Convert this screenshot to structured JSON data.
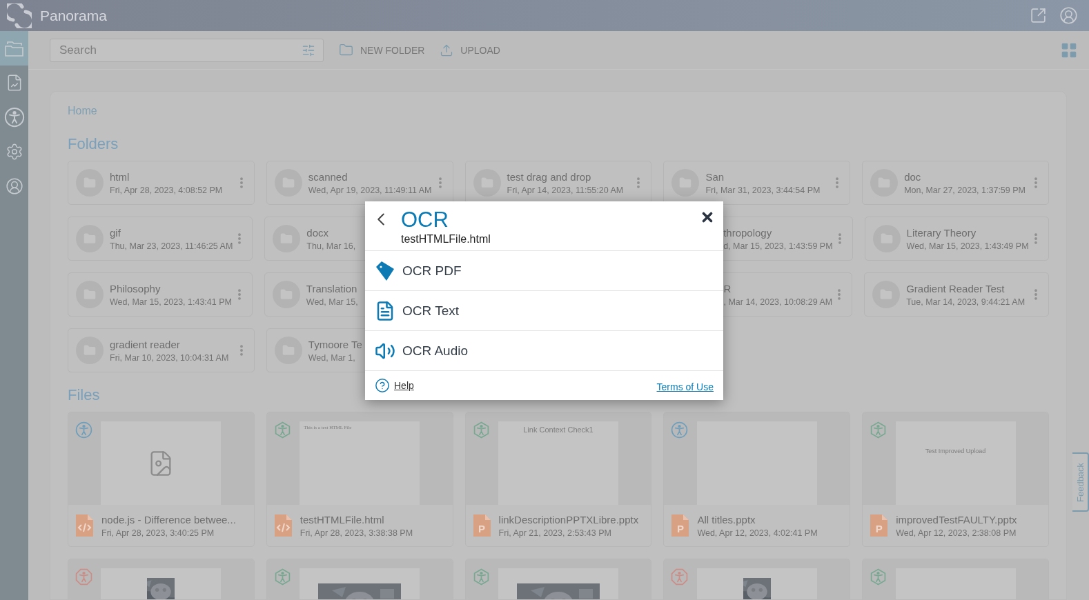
{
  "app": {
    "title": "Panorama"
  },
  "sidebar": {
    "items": [
      {
        "kind": "folders",
        "selected": true
      },
      {
        "kind": "reports",
        "selected": false
      },
      {
        "kind": "accessibility",
        "selected": false
      },
      {
        "kind": "settings",
        "selected": false
      },
      {
        "kind": "account",
        "selected": false
      }
    ]
  },
  "toolbar": {
    "search": {
      "placeholder": "Search"
    },
    "buttons": [
      {
        "kind": "new-folder",
        "label": "NEW FOLDER"
      },
      {
        "kind": "upload",
        "label": "UPLOAD"
      }
    ]
  },
  "breadcrumb": "Home",
  "folders_heading": "Folders",
  "folder_rows": [
    {
      "left": [
        {
          "name": "html",
          "date": "Fri, Apr 28, 2023, 4:08:52 PM"
        },
        {
          "name": "scanned",
          "date": "Wed, Apr 19, 2023, 11:49:11 AM"
        },
        {
          "name": "test drag and drop",
          "date": "Fri, Apr 14, 2023, 11:55:20 AM"
        }
      ],
      "right": [
        {
          "name": "San",
          "date": "Fri, Mar 31, 2023, 3:44:54 PM"
        },
        {
          "name": "doc",
          "date": "Mon, Mar 27, 2023, 1:37:59 PM"
        }
      ]
    },
    {
      "left": [
        {
          "name": "gif",
          "date": "Thu, Mar 23, 2023, 11:46:25 AM"
        },
        {
          "name": "docx",
          "date": "Thu, Mar 16,"
        }
      ],
      "right": [
        {
          "name": "thropology",
          "date": "d, Mar 15, 2023, 1:43:59 PM",
          "kind": "cut-start"
        },
        {
          "name": "Literary Theory",
          "date": "Wed, Mar 15, 2023, 1:43:49 PM"
        }
      ]
    },
    {
      "left": [
        {
          "name": "Philosophy",
          "date": "Wed, Mar 15, 2023, 1:43:41 PM"
        },
        {
          "name": "Translation",
          "date": "Wed, Mar 15,"
        }
      ],
      "right": [
        {
          "name": "R",
          "date": ", Mar 14, 2023, 10:08:29 AM",
          "kind": "cut-start"
        },
        {
          "name": "Gradient Reader Test",
          "date": "Tue, Mar 14, 2023, 9:44:21 AM"
        }
      ]
    },
    {
      "left": [
        {
          "name": "gradient reader",
          "date": "Fri, Mar 10, 2023, 10:04:31 AM"
        },
        {
          "name": "Tymoore Te",
          "date": "Wed, Mar 1,"
        }
      ]
    }
  ],
  "files_heading": "Files",
  "files": [
    {
      "name": "node.js - Difference betwee...",
      "date": "Fri, Apr 28, 2023, 3:40:25 PM",
      "kind": "html",
      "badge": {
        "kind": "circle",
        "color": "#6f9fba"
      },
      "thumbnail": {
        "kind": "none"
      }
    },
    {
      "name": "testHTMLFile.html",
      "date": "Fri, Apr 28, 2023, 3:38:38 PM",
      "kind": "html",
      "badge": {
        "kind": "hexagon",
        "color": "#79a892"
      },
      "thumbnail": {
        "kind": "html",
        "text": "This is a test HTML File"
      }
    },
    {
      "name": "linkDescriptionPPTXLibre.pptx",
      "date": "Fri, Apr 21, 2023, 2:53:43 PM",
      "kind": "pptx",
      "type_letter": "P",
      "badge": {
        "kind": "hexagon",
        "color": "#79a892"
      },
      "thumbnail": {
        "kind": "slide",
        "text": "Link Context Check1"
      }
    },
    {
      "name": "All titles.pptx",
      "date": "Wed, Apr 12, 2023, 4:02:41 PM",
      "kind": "pptx",
      "type_letter": "P",
      "badge": {
        "kind": "circle",
        "color": "#6f9fba"
      },
      "thumbnail": {
        "kind": "blank"
      }
    },
    {
      "name": "improvedTestFAULTY.pptx",
      "date": "Wed, Apr 12, 2023, 2:38:08 PM",
      "kind": "pptx",
      "type_letter": "P",
      "badge": {
        "kind": "hexagon",
        "color": "#79a892"
      },
      "thumbnail": {
        "kind": "title",
        "text": "Test Improved Upload"
      }
    }
  ],
  "files_row2": [
    {
      "badge": {
        "kind": "octagon",
        "color": "#cc8d87"
      },
      "thumbnail": {
        "kind": "small-photo"
      }
    },
    {
      "badge": {
        "kind": "hexagon",
        "color": "#79a892"
      }
    },
    {
      "badge": {
        "kind": "hexagon",
        "color": "#79a892"
      }
    },
    {
      "badge": {
        "kind": "octagon",
        "color": "#cc8d87"
      },
      "thumbnail": {
        "kind": "small-photo"
      }
    },
    {
      "badge": {
        "kind": "hexagon",
        "color": "#79a892"
      },
      "thumbnail": {
        "kind": "blank"
      }
    }
  ],
  "feedback": "Feedback",
  "dialog": {
    "title": "OCR",
    "subtitle": "testHTMLFile.html",
    "options": [
      {
        "kind": "pdf",
        "label": "OCR PDF"
      },
      {
        "kind": "text",
        "label": "OCR Text"
      },
      {
        "kind": "audio",
        "label": "OCR Audio"
      }
    ],
    "help": "Help",
    "terms": "Terms of Use"
  }
}
